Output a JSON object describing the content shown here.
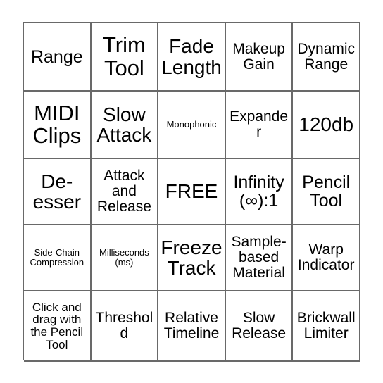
{
  "card": {
    "type": "bingo-card",
    "columns": 5,
    "rows": 5,
    "border_color": "#696969",
    "background_color": "#ffffff",
    "text_color": "#000000",
    "cells": [
      {
        "text": "Range",
        "size": "lg"
      },
      {
        "text": "Trim\nTool",
        "size": "xxl"
      },
      {
        "text": "Fade\nLength",
        "size": "xl"
      },
      {
        "text": "Makeup\nGain",
        "size": "md"
      },
      {
        "text": "Dynamic\nRange",
        "size": "md"
      },
      {
        "text": "MIDI\nClips",
        "size": "xxl"
      },
      {
        "text": "Slow\nAttack",
        "size": "xl"
      },
      {
        "text": "Monophonic",
        "size": "xs"
      },
      {
        "text": "Expander",
        "size": "md"
      },
      {
        "text": "120db",
        "size": "xl"
      },
      {
        "text": "De-\nesser",
        "size": "xl"
      },
      {
        "text": "Attack\nand\nRelease",
        "size": "md"
      },
      {
        "text": "FREE",
        "size": "xl"
      },
      {
        "text": "Infinity\n(∞):1",
        "size": "lg"
      },
      {
        "text": "Pencil\nTool",
        "size": "lg"
      },
      {
        "text": "Side-Chain\nCompression",
        "size": "xs"
      },
      {
        "text": "Milliseconds\n(ms)",
        "size": "xs"
      },
      {
        "text": "Freeze\nTrack",
        "size": "xl"
      },
      {
        "text": "Sample-\nbased\nMaterial",
        "size": "md"
      },
      {
        "text": "Warp\nIndicator",
        "size": "md"
      },
      {
        "text": "Click and\ndrag with\nthe Pencil\nTool",
        "size": "sm"
      },
      {
        "text": "Threshold",
        "size": "md"
      },
      {
        "text": "Relative\nTimeline",
        "size": "md"
      },
      {
        "text": "Slow\nRelease",
        "size": "md"
      },
      {
        "text": "Brickwall\nLimiter",
        "size": "md"
      }
    ]
  }
}
